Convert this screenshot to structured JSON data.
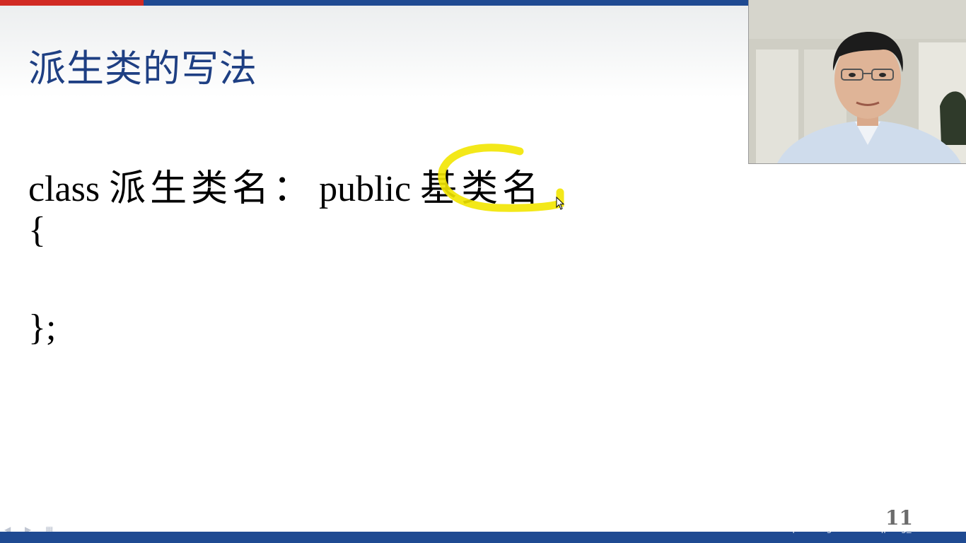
{
  "slide": {
    "title": "派生类的写法",
    "code_line_1_prefix": "class",
    "code_line_1_cjk": "派生类名",
    "code_line_1_colon": "：",
    "code_line_1_public": "public",
    "code_line_1_base": "基类名",
    "code_line_2": "{",
    "code_line_3": "};",
    "page_number": "11"
  },
  "watermark": "https://blog.csdn.net/qpeng_master",
  "colors": {
    "title": "#1e3f83",
    "top_bar_red": "#d12a24",
    "top_bar_blue": "#1f4a92",
    "highlight": "#f2e600"
  }
}
